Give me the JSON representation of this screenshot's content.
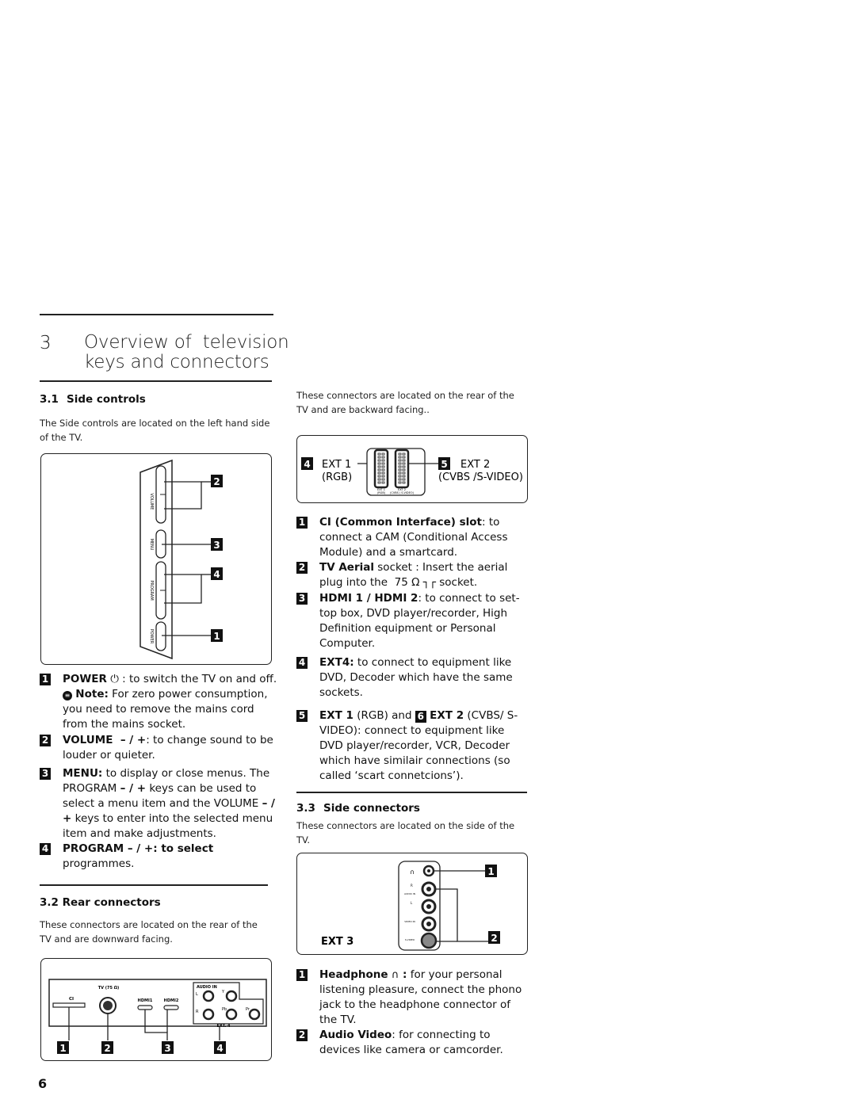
{
  "chapter": {
    "number": "3",
    "title_line1": "Overview of  television",
    "title_line2": "keys and connectors"
  },
  "side_controls": {
    "heading_num": "3.1",
    "heading": "Side controls",
    "intro": "The Side controls are located on the left hand side of the TV.",
    "diagram": {
      "labels": [
        "VOLUME",
        "MENU",
        "PROGRAM",
        "POWER"
      ],
      "badges": [
        "2",
        "3",
        "4",
        "1"
      ]
    },
    "items": [
      {
        "badge": "1",
        "bold": "POWER",
        "icon": "power-icon",
        "text1": " : to switch the TV on and off. ",
        "note_icon": "note-icon",
        "note_bold": "Note:",
        "text2": " For zero power consumption, you need to remove the mains cord from the mains socket."
      },
      {
        "badge": "2",
        "bold": "VOLUME  – / +",
        "text": ": to change sound to be   louder or quieter."
      },
      {
        "badge": "3",
        "bold": "MENU:",
        "text_a": " to display or close menus. The PROGRAM ",
        "bold_b": "– / +",
        "text_b": " keys can be used to select a menu item and the VOLUME ",
        "bold_c": "– / +",
        "text_c": " keys to enter into the selected menu item and make adjustments."
      },
      {
        "badge": "4",
        "bold": "PROGRAM – / +: to select",
        "text": " programmes."
      }
    ]
  },
  "rear_connectors": {
    "heading": "3.2 Rear connectors",
    "intro": "These connectors are located on the rear of the TV and are downward facing.",
    "diagram": {
      "ci_label": "CI",
      "tv_label": "TV (75 Ω)",
      "hdmi1": "HDMI1",
      "hdmi2": "HDMI2",
      "audio_in": "AUDIO IN",
      "l": "L",
      "r": "R",
      "y": "Y",
      "pb": "Pb",
      "pr": "Pr",
      "ext4": "EXT. 4",
      "badges": [
        "1",
        "2",
        "3",
        "4"
      ]
    }
  },
  "backward": {
    "intro": "These connectors are located on the rear of the TV and are backward facing..",
    "diagram": {
      "badge_left": "4",
      "left_label1": "EXT 1",
      "left_label2": "(RGB)",
      "badge_right": "5",
      "right_label1": "EXT 2",
      "right_label2": "(CVBS /S-VIDEO)",
      "scart1_caption1": "EXT 1",
      "scart1_caption2": "(RGB)",
      "scart2_caption1": "EXT 2",
      "scart2_caption2": "(CVBS / S-VIDEO)"
    },
    "items": [
      {
        "badge": "1",
        "bold": "CI (Common Interface) slot",
        "text": ": to connect a CAM (Conditional Access Module) and a smartcard."
      },
      {
        "badge": "2",
        "bold": "TV Aerial",
        "text": " socket : Insert the aerial plug into the  75 Ω ",
        "icon": "aerial-icon",
        "text2": " socket."
      },
      {
        "badge": "3",
        "bold": "HDMI 1 / HDMI 2",
        "text": ": to connect to set-top box, DVD player/recorder, High Definition equipment or Personal Computer."
      },
      {
        "badge": "4",
        "bold": "EXT4:",
        "text": " to connect to equipment like DVD, Decoder which have the same sockets."
      },
      {
        "badge": "5",
        "bold": "EXT 1",
        "text": " (RGB) and ",
        "badge2": "6",
        "bold2": "EXT 2",
        "text2": " (CVBS/ S-VIDEO): connect to equipment like DVD player/recorder, VCR, Decoder which have similair connections (so called ‘scart connetcions’)."
      }
    ]
  },
  "side_connectors": {
    "heading_num": "3.3",
    "heading": "Side connectors",
    "intro": "These connectors are located on the side of the TV.",
    "diagram": {
      "ext3": "EXT 3",
      "audio_in": "AUDIO IN",
      "r": "R",
      "l": "L",
      "video_in": "VIDEO IN",
      "svideo": "S-VIDEO",
      "badges": [
        "1",
        "2"
      ]
    },
    "items": [
      {
        "badge": "1",
        "bold": "Headphone",
        "icon": "headphone-icon",
        "bold2": " :",
        "text": " for your personal listening pleasure, connect the phono jack to the headphone connector of the TV."
      },
      {
        "badge": "2",
        "bold": "Audio Video",
        "text": ": for connecting to devices like camera or camcorder."
      }
    ]
  },
  "page_number": "6"
}
